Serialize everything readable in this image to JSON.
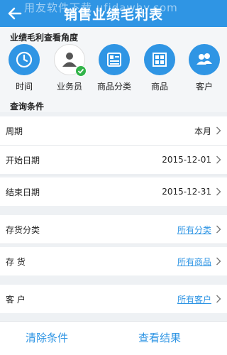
{
  "header": {
    "title": "销售业绩毛利表",
    "back_icon": "back-arrow-icon",
    "watermark": "用友软件下载  ufidawhy.com"
  },
  "perspective": {
    "label": "业绩毛利查看角度",
    "items": [
      {
        "label": "时间",
        "icon": "clock-icon"
      },
      {
        "label": "业务员",
        "icon": "person-check-icon"
      },
      {
        "label": "商品分类",
        "icon": "category-icon"
      },
      {
        "label": "商品",
        "icon": "grid-icon"
      },
      {
        "label": "客户",
        "icon": "users-icon"
      }
    ]
  },
  "query": {
    "label": "查询条件",
    "rows": [
      {
        "label": "周期",
        "value": "本月"
      },
      {
        "label": "开始日期",
        "value": "2015-12-01"
      },
      {
        "label": "结束日期",
        "value": "2015-12-31"
      },
      {
        "label": "存货分类",
        "value": "所有分类"
      },
      {
        "label": "存 货",
        "value": "所有商品"
      },
      {
        "label": "客 户",
        "value": "所有客户"
      }
    ]
  },
  "footer": {
    "clear_label": "清除条件",
    "view_label": "查看结果"
  },
  "colors": {
    "accent": "#2f95e4",
    "badge": "#32b44a",
    "background": "#eef1f4"
  }
}
